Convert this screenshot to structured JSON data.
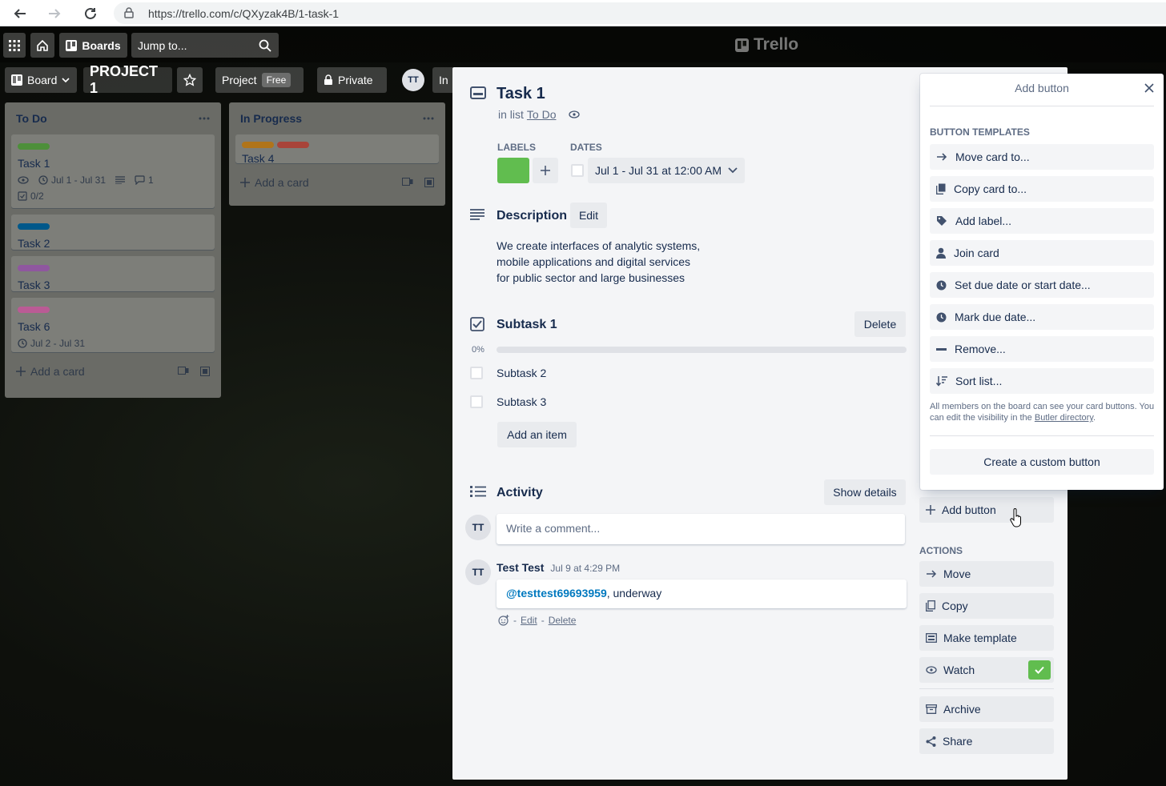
{
  "browser": {
    "url": "https://trello.com/c/QXyzak4B/1-task-1"
  },
  "topbar": {
    "boards": "Boards",
    "search_placeholder": "Jump to...",
    "logo": "Trello"
  },
  "boardbar": {
    "view": "Board",
    "board_name": "PROJECT 1",
    "workspace": "Project",
    "plan": "Free",
    "visibility": "Private",
    "member": "TT",
    "invite_partial": "In"
  },
  "lists": [
    {
      "title": "To Do",
      "cards": [
        {
          "title": "Task 1",
          "labels": [
            "#61bd4f"
          ],
          "dates": "Jul 1 - Jul 31",
          "comments": "1",
          "checklist": "0/2"
        },
        {
          "title": "Task 2",
          "labels": [
            "#0079bf"
          ]
        },
        {
          "title": "Task 3",
          "labels": [
            "#c377e0"
          ]
        },
        {
          "title": "Task 6",
          "labels": [
            "#ff78cb"
          ],
          "dates": "Jul 2 - Jul 31"
        }
      ],
      "add": "Add a card"
    },
    {
      "title": "In Progress",
      "cards": [
        {
          "title": "Task 4",
          "labels": [
            "#ff9f1a",
            "#eb5a46"
          ]
        }
      ],
      "add": "Add a card"
    }
  ],
  "card": {
    "title": "Task 1",
    "in_list_prefix": "in list",
    "list_name": "To Do",
    "labels_heading": "LABELS",
    "label_color": "#61bd4f",
    "dates_heading": "DATES",
    "dates_value": "Jul 1 - Jul 31 at 12:00 AM",
    "description_heading": "Description",
    "edit": "Edit",
    "description": [
      "We create interfaces of analytic systems,",
      "mobile applications and digital services",
      "for public sector and large businesses"
    ],
    "checklist_title": "Subtask 1",
    "delete": "Delete",
    "progress": "0%",
    "progress_value": 0,
    "items": [
      "Subtask 2",
      "Subtask 3"
    ],
    "add_item": "Add an item",
    "activity_heading": "Activity",
    "show_details": "Show details",
    "comment_placeholder": "Write a comment...",
    "avatar": "TT",
    "comment": {
      "author": "Test Test",
      "time": "Jul 9 at 4:29 PM",
      "mention": "@testtest69693959",
      "text": ", underway",
      "sep1": "-",
      "edit": "Edit",
      "sep2": "-",
      "delete": "Delete"
    }
  },
  "sidebar": {
    "add_button": "Add button",
    "actions_heading": "ACTIONS",
    "move": "Move",
    "copy": "Copy",
    "make_template": "Make template",
    "watch": "Watch",
    "archive": "Archive",
    "share": "Share"
  },
  "popover": {
    "title": "Add button",
    "section": "BUTTON TEMPLATES",
    "templates": [
      "Move card to...",
      "Copy card to...",
      "Add label...",
      "Join card",
      "Set due date or start date...",
      "Mark due date...",
      "Remove...",
      "Sort list..."
    ],
    "note_prefix": "All members on the board can see your card buttons. You can edit the visibility in the",
    "note_link": "Butler directory",
    "note_suffix": ".",
    "create": "Create a custom button"
  },
  "colors": {
    "green": "#61bd4f",
    "link": "#0079bf"
  }
}
